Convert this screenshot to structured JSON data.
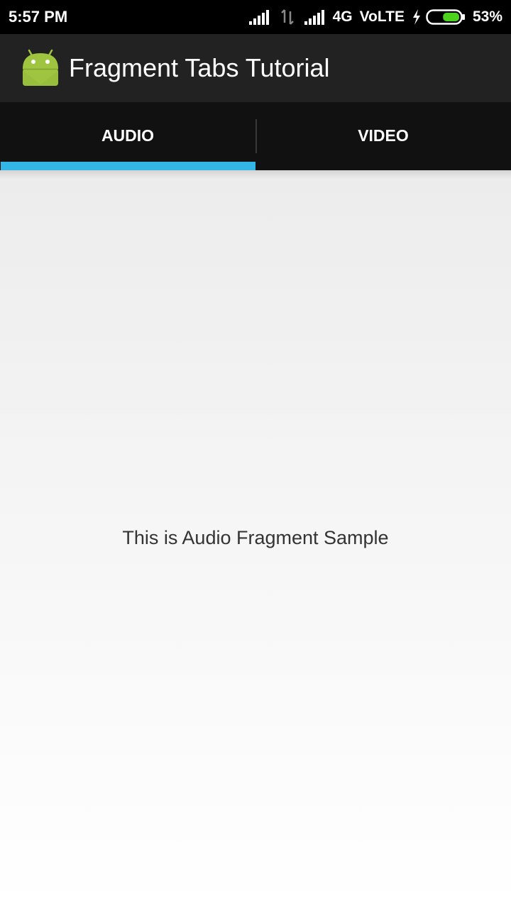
{
  "status_bar": {
    "time": "5:57 PM",
    "network": "4G",
    "volte": "VoLTE",
    "battery_percent": "53%",
    "battery_level": 0.53,
    "battery_color": "#4cd21c",
    "icons": [
      "signal-icon",
      "data-arrows-icon",
      "signal-icon",
      "charging-bolt-icon",
      "battery-icon"
    ]
  },
  "action_bar": {
    "title": "Fragment Tabs Tutorial",
    "icon": "android-icon",
    "icon_color": "#9fc540"
  },
  "tabs": [
    {
      "label": "AUDIO",
      "selected": true
    },
    {
      "label": "VIDEO",
      "selected": false
    }
  ],
  "accent_color": "#33b5e5",
  "content": {
    "text": "This is Audio Fragment Sample"
  }
}
